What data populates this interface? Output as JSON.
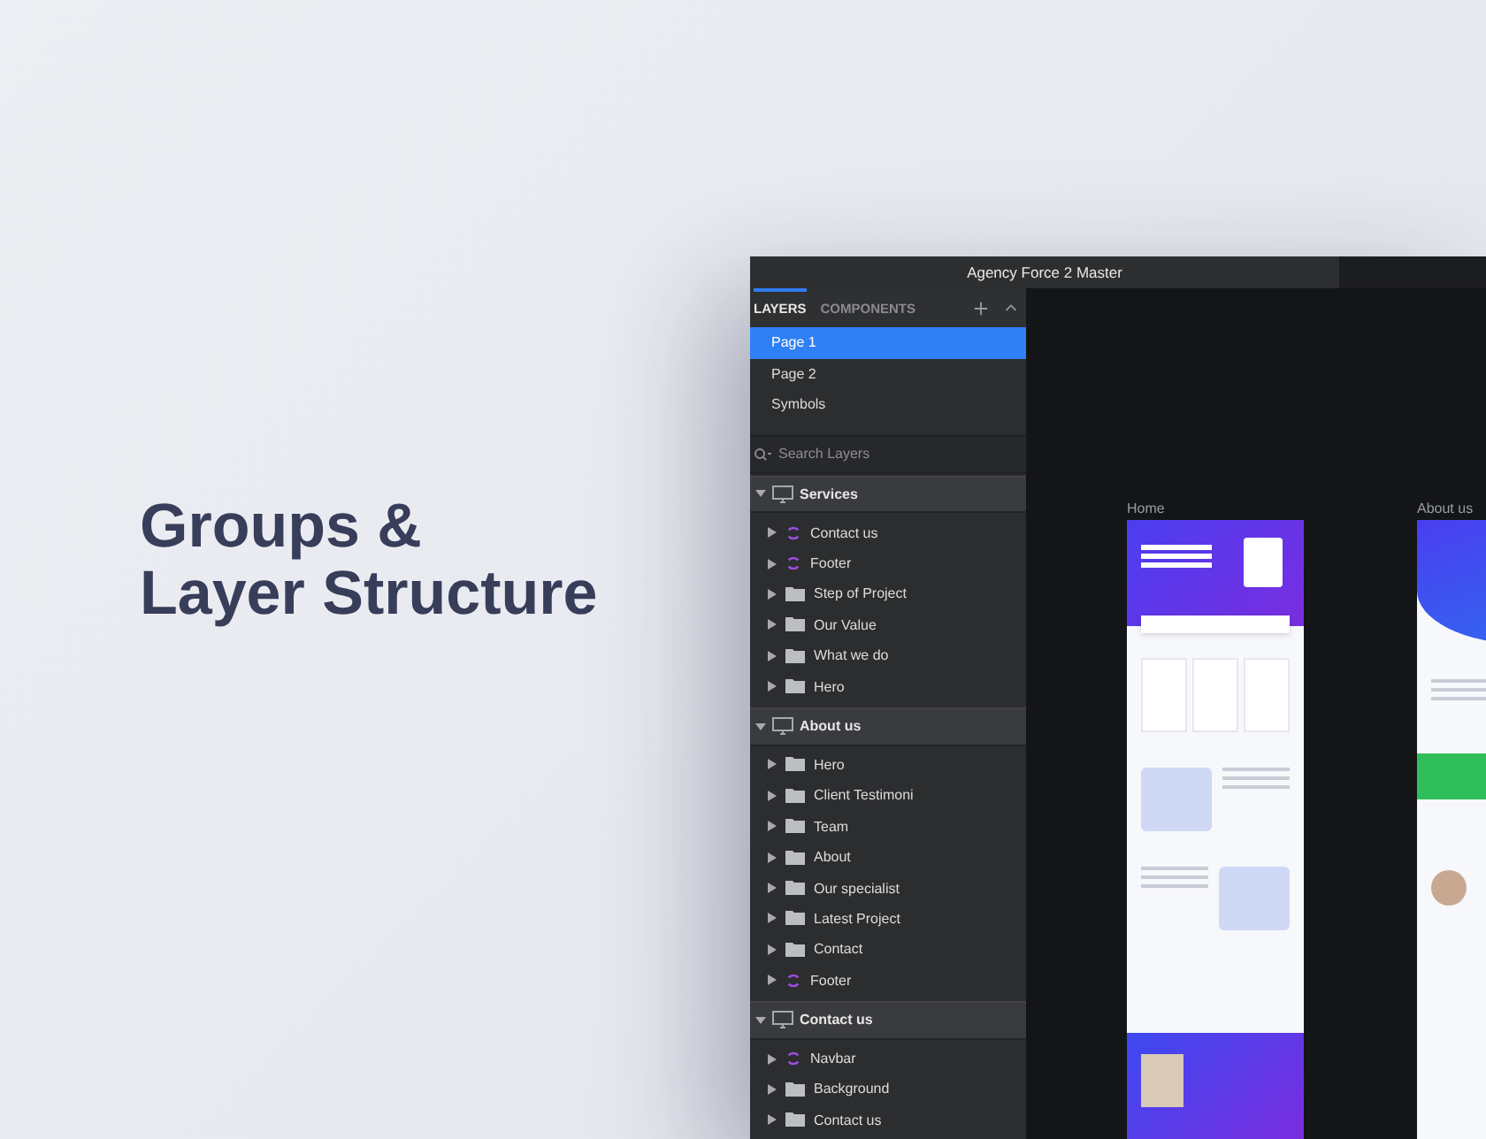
{
  "heading": {
    "lines": [
      "Groups &",
      "Layer Structure"
    ]
  },
  "window": {
    "title": "Agency Force 2 Master"
  },
  "tabs": [
    {
      "label": "LAYERS",
      "selected": true
    },
    {
      "label": "COMPONENTS",
      "selected": false
    }
  ],
  "pages": [
    {
      "label": "Page 1",
      "selected": true
    },
    {
      "label": "Page 2",
      "selected": false
    },
    {
      "label": "Symbols",
      "selected": false
    }
  ],
  "search": {
    "placeholder": "Search Layers"
  },
  "groups": [
    {
      "name": "Services",
      "expanded": true,
      "children": [
        {
          "name": "Contact us",
          "kind": "symbol"
        },
        {
          "name": "Footer",
          "kind": "symbol"
        },
        {
          "name": "Step of Project",
          "kind": "folder"
        },
        {
          "name": "Our Value",
          "kind": "folder"
        },
        {
          "name": "What we do",
          "kind": "folder"
        },
        {
          "name": "Hero",
          "kind": "folder"
        }
      ]
    },
    {
      "name": "About us",
      "expanded": true,
      "children": [
        {
          "name": "Hero",
          "kind": "folder"
        },
        {
          "name": "Client Testimoni",
          "kind": "folder"
        },
        {
          "name": "Team",
          "kind": "folder"
        },
        {
          "name": "About",
          "kind": "folder"
        },
        {
          "name": "Our specialist",
          "kind": "folder"
        },
        {
          "name": "Latest Project",
          "kind": "folder"
        },
        {
          "name": "Contact",
          "kind": "folder"
        },
        {
          "name": "Footer",
          "kind": "symbol"
        }
      ]
    },
    {
      "name": "Contact us",
      "expanded": true,
      "children": [
        {
          "name": "Navbar",
          "kind": "symbol"
        },
        {
          "name": "Background",
          "kind": "folder"
        },
        {
          "name": "Contact us",
          "kind": "folder"
        }
      ]
    }
  ],
  "artboards": [
    {
      "label": "Home",
      "kind": "home"
    },
    {
      "label": "About us",
      "kind": "about"
    }
  ]
}
